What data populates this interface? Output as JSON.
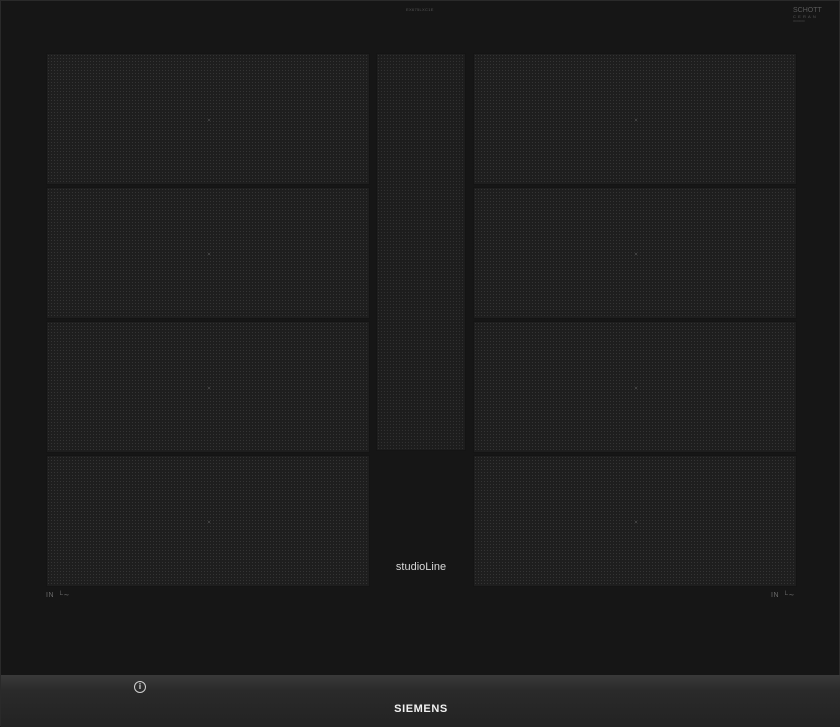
{
  "cooktop": {
    "top_label": "EX675LXC1E",
    "glass_brand": {
      "name": "SCHOTT",
      "line": "CERAN",
      "note": "0000000"
    },
    "series_label": "studioLine",
    "induction_left": {
      "label": "IN",
      "symbol": "└∼"
    },
    "induction_right": {
      "label": "IN",
      "symbol": "└∼"
    },
    "info_icon": "info-icon",
    "brand_logo": "SIEMENS",
    "left_zones": 4,
    "right_zones": 4
  }
}
